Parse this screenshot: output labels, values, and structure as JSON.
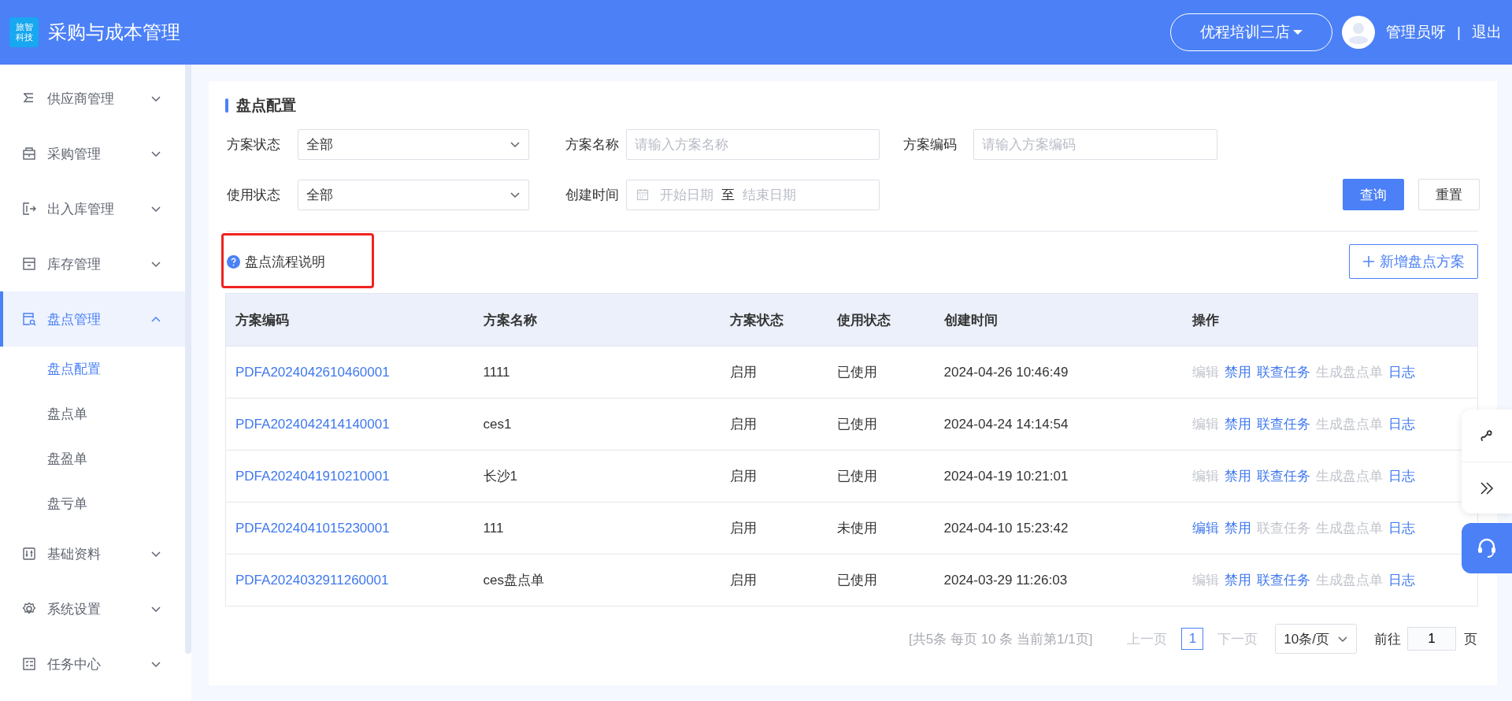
{
  "header": {
    "logo_lines": [
      "旅智",
      "科技"
    ],
    "title": "采购与成本管理",
    "store": "优程培训三店",
    "user": "管理员呀",
    "separator": "|",
    "logout": "退出"
  },
  "sidebar": {
    "items": [
      {
        "label": "供应商管理",
        "expanded": false,
        "selected": false
      },
      {
        "label": "采购管理",
        "expanded": false,
        "selected": false
      },
      {
        "label": "出入库管理",
        "expanded": false,
        "selected": false
      },
      {
        "label": "库存管理",
        "expanded": false,
        "selected": false
      },
      {
        "label": "盘点管理",
        "expanded": true,
        "selected": true,
        "children": [
          {
            "label": "盘点配置",
            "selected": true
          },
          {
            "label": "盘点单",
            "selected": false
          },
          {
            "label": "盘盈单",
            "selected": false
          },
          {
            "label": "盘亏单",
            "selected": false
          }
        ]
      },
      {
        "label": "基础资料",
        "expanded": false,
        "selected": false
      },
      {
        "label": "系统设置",
        "expanded": false,
        "selected": false
      },
      {
        "label": "任务中心",
        "expanded": false,
        "selected": false
      }
    ]
  },
  "page": {
    "title": "盘点配置"
  },
  "filters": [
    {
      "kind": "select",
      "label": "方案状态",
      "value": "全部"
    },
    {
      "kind": "text",
      "label": "方案名称",
      "placeholder": "请输入方案名称"
    },
    {
      "kind": "text",
      "label": "方案编码",
      "placeholder": "请输入方案编码"
    },
    {
      "kind": "select",
      "label": "使用状态",
      "value": "全部"
    },
    {
      "kind": "daterange",
      "label": "创建时间",
      "start_placeholder": "开始日期",
      "separator": "至",
      "end_placeholder": "结束日期"
    }
  ],
  "query_button": "查询",
  "reset_button": "重置",
  "help_link": "盘点流程说明",
  "add_button": "新增盘点方案",
  "table": {
    "columns": [
      "方案编码",
      "方案名称",
      "方案状态",
      "使用状态",
      "创建时间",
      "操作"
    ],
    "rows": [
      {
        "code": "PDFA2024042610460001",
        "name": "1111",
        "status": "启用",
        "usage": "已使用",
        "created": "2024-04-26 10:46:49",
        "actions": [
          {
            "label": "编辑",
            "disabled": true
          },
          {
            "label": "禁用",
            "disabled": false
          },
          {
            "label": "联查任务",
            "disabled": false
          },
          {
            "label": "生成盘点单",
            "disabled": true
          },
          {
            "label": "日志",
            "disabled": false
          }
        ]
      },
      {
        "code": "PDFA2024042414140001",
        "name": "ces1",
        "status": "启用",
        "usage": "已使用",
        "created": "2024-04-24 14:14:54",
        "actions": [
          {
            "label": "编辑",
            "disabled": true
          },
          {
            "label": "禁用",
            "disabled": false
          },
          {
            "label": "联查任务",
            "disabled": false
          },
          {
            "label": "生成盘点单",
            "disabled": true
          },
          {
            "label": "日志",
            "disabled": false
          }
        ]
      },
      {
        "code": "PDFA2024041910210001",
        "name": "长沙1",
        "status": "启用",
        "usage": "已使用",
        "created": "2024-04-19 10:21:01",
        "actions": [
          {
            "label": "编辑",
            "disabled": true
          },
          {
            "label": "禁用",
            "disabled": false
          },
          {
            "label": "联查任务",
            "disabled": false
          },
          {
            "label": "生成盘点单",
            "disabled": true
          },
          {
            "label": "日志",
            "disabled": false
          }
        ]
      },
      {
        "code": "PDFA2024041015230001",
        "name": "111",
        "status": "启用",
        "usage": "未使用",
        "created": "2024-04-10 15:23:42",
        "actions": [
          {
            "label": "编辑",
            "disabled": false
          },
          {
            "label": "禁用",
            "disabled": false
          },
          {
            "label": "联查任务",
            "disabled": true
          },
          {
            "label": "生成盘点单",
            "disabled": true
          },
          {
            "label": "日志",
            "disabled": false
          }
        ]
      },
      {
        "code": "PDFA2024032911260001",
        "name": "ces盘点单",
        "status": "启用",
        "usage": "已使用",
        "created": "2024-03-29 11:26:03",
        "actions": [
          {
            "label": "编辑",
            "disabled": true
          },
          {
            "label": "禁用",
            "disabled": false
          },
          {
            "label": "联查任务",
            "disabled": false
          },
          {
            "label": "生成盘点单",
            "disabled": true
          },
          {
            "label": "日志",
            "disabled": false
          }
        ]
      }
    ]
  },
  "pagination": {
    "summary": "[共5条 每页 10 条 当前第1/1页]",
    "prev": {
      "label": "上一页",
      "disabled": true
    },
    "pages": [
      {
        "label": "1",
        "selected": true
      }
    ],
    "next": {
      "label": "下一页",
      "disabled": true
    },
    "page_size": "10条/页",
    "goto_label": "前往",
    "goto_value": "1",
    "page_unit": "页"
  }
}
